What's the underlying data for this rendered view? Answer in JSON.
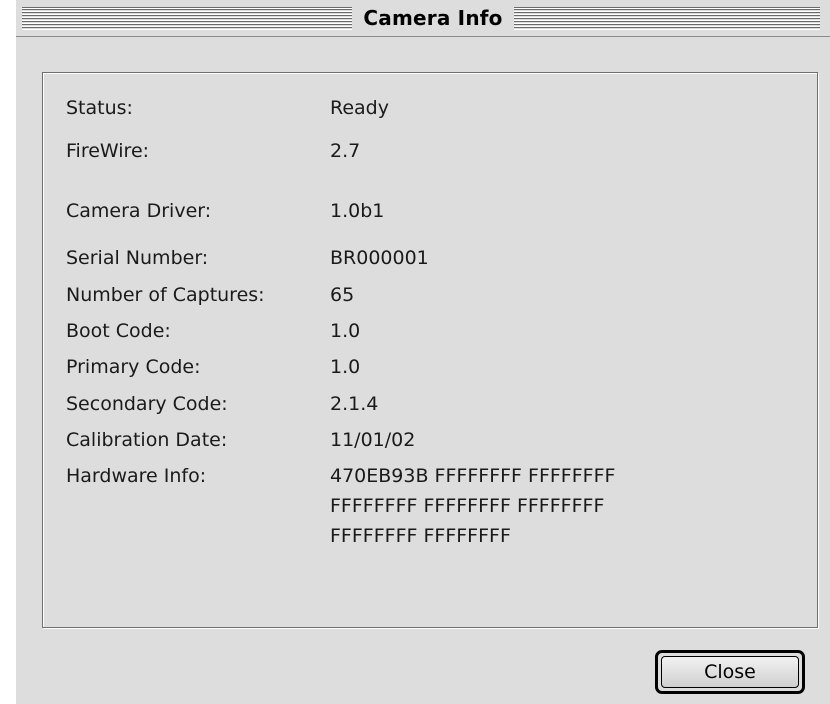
{
  "window": {
    "title": "Camera Info"
  },
  "info": {
    "status": {
      "label": "Status:",
      "value": "Ready"
    },
    "firewire": {
      "label": "FireWire:",
      "value": "2.7"
    },
    "camera_driver": {
      "label": "Camera Driver:",
      "value": "1.0b1"
    },
    "serial_number": {
      "label": "Serial Number:",
      "value": "BR000001"
    },
    "number_of_captures": {
      "label": "Number of Captures:",
      "value": "65"
    },
    "boot_code": {
      "label": "Boot Code:",
      "value": "1.0"
    },
    "primary_code": {
      "label": "Primary Code:",
      "value": "1.0"
    },
    "secondary_code": {
      "label": "Secondary Code:",
      "value": "2.1.4"
    },
    "calibration_date": {
      "label": "Calibration Date:",
      "value": "11/01/02"
    },
    "hardware_info": {
      "label": "Hardware Info:",
      "lines": [
        "470EB93B FFFFFFFF FFFFFFFF",
        "FFFFFFFF FFFFFFFF FFFFFFFF",
        "FFFFFFFF FFFFFFFF"
      ]
    }
  },
  "buttons": {
    "close_label": "Close"
  }
}
